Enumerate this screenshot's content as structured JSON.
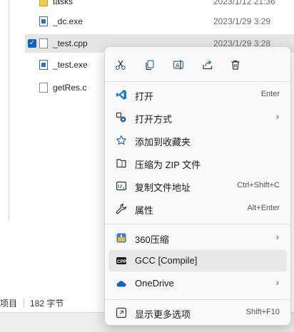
{
  "files": [
    {
      "name": "tasks",
      "date": "2023/1/12 21:36",
      "icon": "folder-icon",
      "selected": false
    },
    {
      "name": "_dc.exe",
      "date": "2023/1/29 3:29",
      "icon": "exe-icon",
      "selected": false
    },
    {
      "name": "_test.cpp",
      "date": "2023/1/29 3:28",
      "icon": "cpp-file-icon",
      "selected": true
    },
    {
      "name": "_test.exe",
      "date": "",
      "icon": "exe-icon",
      "selected": false
    },
    {
      "name": "getRes.c",
      "date": "",
      "icon": "c-file-icon",
      "selected": false
    }
  ],
  "status": {
    "items_text": "项目",
    "size_text": "182 字节"
  },
  "quick_actions": [
    {
      "name": "cut-icon"
    },
    {
      "name": "copy-icon"
    },
    {
      "name": "rename-icon"
    },
    {
      "name": "share-icon"
    },
    {
      "name": "delete-icon"
    }
  ],
  "menu": {
    "open": {
      "label": "打开",
      "shortcut": "Enter"
    },
    "open_with": {
      "label": "打开方式"
    },
    "favorite": {
      "label": "添加到收藏夹"
    },
    "zip": {
      "label": "压缩为 ZIP 文件"
    },
    "copy_path": {
      "label": "复制文件地址",
      "shortcut": "Ctrl+Shift+C"
    },
    "properties": {
      "label": "属性",
      "shortcut": "Alt+Enter"
    },
    "zip360": {
      "label": "360压缩"
    },
    "gcc": {
      "label": "GCC [Compile]"
    },
    "onedrive": {
      "label": "OneDrive"
    },
    "more": {
      "label": "显示更多选项",
      "shortcut": "Shift+F10"
    }
  },
  "colors": {
    "accent": "#0a64c8",
    "menu_bg": "#f9f9f9",
    "hover": "#e8e8e8"
  }
}
